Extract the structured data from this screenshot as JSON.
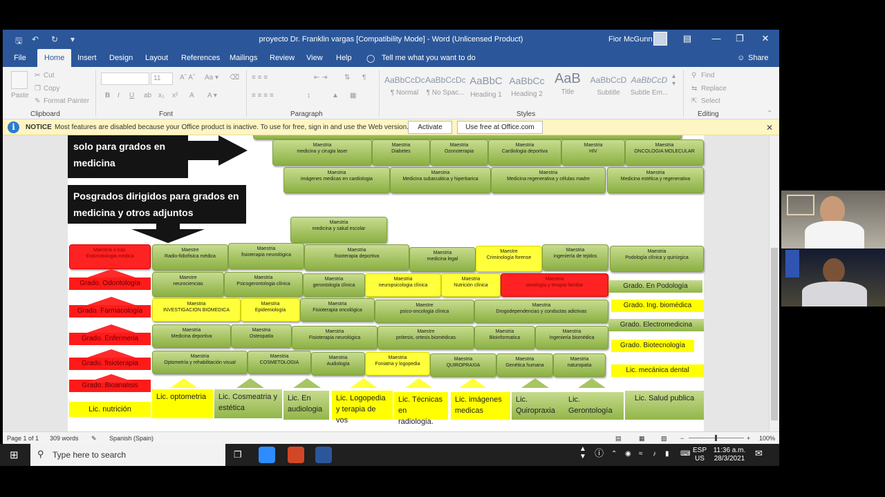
{
  "window": {
    "title": "proyecto Dr. Franklin vargas [Compatibility Mode]  -  Word (Unlicensed Product)",
    "user": "Fior McGunn"
  },
  "tabs": [
    "File",
    "Home",
    "Insert",
    "Design",
    "Layout",
    "References",
    "Mailings",
    "Review",
    "View",
    "Help"
  ],
  "tell_me": "Tell me what you want to do",
  "share": "Share",
  "ribbon": {
    "clipboard": {
      "label": "Clipboard",
      "paste": "Paste",
      "cut": "Cut",
      "copy": "Copy",
      "format_painter": "Format Painter"
    },
    "font": {
      "label": "Font",
      "size": "11"
    },
    "paragraph": {
      "label": "Paragraph"
    },
    "styles": {
      "label": "Styles",
      "items": [
        {
          "preview": "AaBbCcDc",
          "name": "¶ Normal"
        },
        {
          "preview": "AaBbCcDc",
          "name": "¶ No Spac..."
        },
        {
          "preview": "AaBbC",
          "name": "Heading 1"
        },
        {
          "preview": "AaBbCc",
          "name": "Heading 2"
        },
        {
          "preview": "AaB",
          "name": "Title"
        },
        {
          "preview": "AaBbCcD",
          "name": "Subtitle"
        },
        {
          "preview": "AaBbCcD",
          "name": "Subtle Em..."
        }
      ]
    },
    "editing": {
      "label": "Editing",
      "find": "Find",
      "replace": "Replace",
      "select": "Select"
    }
  },
  "notice": {
    "label": "NOTICE",
    "text": "Most features are disabled because your Office product is inactive. To use for free, sign in and use the Web version.",
    "activate": "Activate",
    "web": "Use free at Office.com"
  },
  "doc": {
    "header1": "solo para  grados en medicina",
    "header2": "Posgrados dirigidos para grados en medicina y otros  adjuntos",
    "masters": [
      {
        "k": "Maestria",
        "v": "medicina  y cirugia laser"
      },
      {
        "k": "Maestria",
        "v": "Diabetes"
      },
      {
        "k": "Maestria",
        "v": "Ozonoterapia"
      },
      {
        "k": "Maestria",
        "v": "Cardiologia deportiva"
      },
      {
        "k": "Maestria",
        "v": "HIV"
      },
      {
        "k": "Maestria",
        "v": "ONCOLOGIA MOLECULAR"
      },
      {
        "k": "Maestria",
        "v": "imágenes medicas en cardiologia"
      },
      {
        "k": "Maestria",
        "v": "Medicina subacuática y hiperbarica"
      },
      {
        "k": "Maestria",
        "v": "Medicina regenerativa y células madre"
      },
      {
        "k": "Maestria",
        "v": "Medicina estética y regenerativa"
      },
      {
        "k": "Maestria",
        "v": "medicina y salud escolar"
      },
      {
        "k": "Maestria   o esp.",
        "v": "Estomatologia medica"
      },
      {
        "k": "Maestre",
        "v": "Radio-fidiofisica médica"
      },
      {
        "k": "Maestria",
        "v": "fisioterapia neurológica"
      },
      {
        "k": "Maestria",
        "v": "fisioterapia deportiva"
      },
      {
        "k": "Maestria",
        "v": "medicina legal"
      },
      {
        "k": "Maestre",
        "v": "Criminología forense"
      },
      {
        "k": "Maestria",
        "v": "ingeniería de tejidos"
      },
      {
        "k": "Maestria",
        "v": "Podología clínica  y  quirúrgica"
      },
      {
        "k": "Maestre",
        "v": "neurociencias"
      },
      {
        "k": "Maestria",
        "v": "Psicogerontologia clínica"
      },
      {
        "k": "Maestria",
        "v": "gerontología clínica"
      },
      {
        "k": "Maestria",
        "v": "neuropsicologia clínica"
      },
      {
        "k": "Maestria",
        "v": "Nutrición clínica"
      },
      {
        "k": "Maestria",
        "v": "sexología y terapia familiar"
      },
      {
        "k": "Maestria",
        "v": "INVESTIGACION BIOMEDICA"
      },
      {
        "k": "Maestria",
        "v": "Epidemiología"
      },
      {
        "k": "Maestria",
        "v": "Fisioterapia oncológica"
      },
      {
        "k": "Maestre",
        "v": "psico-oncologia clínica"
      },
      {
        "k": "Maestria",
        "v": "Drogodependencias y conductas adictivas"
      },
      {
        "k": "Maestria",
        "v": "Medicina deportiva"
      },
      {
        "k": "Maestria",
        "v": "Osteopatía"
      },
      {
        "k": "Maestria",
        "v": "Fisioterapia neurológica"
      },
      {
        "k": "Maestre",
        "v": "prótesis, ortesis  biomédicas"
      },
      {
        "k": "Maestria",
        "v": "Bioinformatica"
      },
      {
        "k": "Maestria",
        "v": "Ingeniería biomédica"
      },
      {
        "k": "Maestria",
        "v": "Optometría y rehabilitación visual"
      },
      {
        "k": "Maestria",
        "v": "COSMETOLOGIA"
      },
      {
        "k": "Maestria",
        "v": "Audiología"
      },
      {
        "k": "Maestria",
        "v": "Foniatria y logopedia"
      },
      {
        "k": "Maestria",
        "v": "QUIROPRAXIA"
      },
      {
        "k": "Maestria",
        "v": "Genética humana"
      },
      {
        "k": "Maestria",
        "v": "naturopatia"
      }
    ],
    "grades": [
      "Grado.  Odontología",
      "Grado.  Farmacología",
      "Grado.  Enfermeria",
      "Grado.  fisioterapia",
      "Grado.  Bioanalisis",
      "Grado.  En Podología",
      "Grado.  Ing. biomédica",
      "Grado.  Electromedicina",
      "Grado.  Biotecnología",
      "Lic. mecánica dental"
    ],
    "lics": [
      "Lic. nutrición",
      "Lic. optometria",
      "Lic. Cosmeatria  y  estética",
      "Lic. En audiologia",
      "Lic.  Logopedia y terapia de vos",
      "Lic. Técnicas en radiologia.",
      "Lic. imágenes medicas",
      "Lic. Quiropraxia",
      "Lic. Gerontología",
      "Lic. Salud publica"
    ]
  },
  "status": {
    "page": "Page 1 of 1",
    "words": "309 words",
    "lang": "Spanish (Spain)",
    "zoom": "100%"
  },
  "taskbar": {
    "search": "Type here to search",
    "lang1": "ESP",
    "lang2": "US",
    "time": "11:36 a.m.",
    "date": "28/3/2021"
  }
}
